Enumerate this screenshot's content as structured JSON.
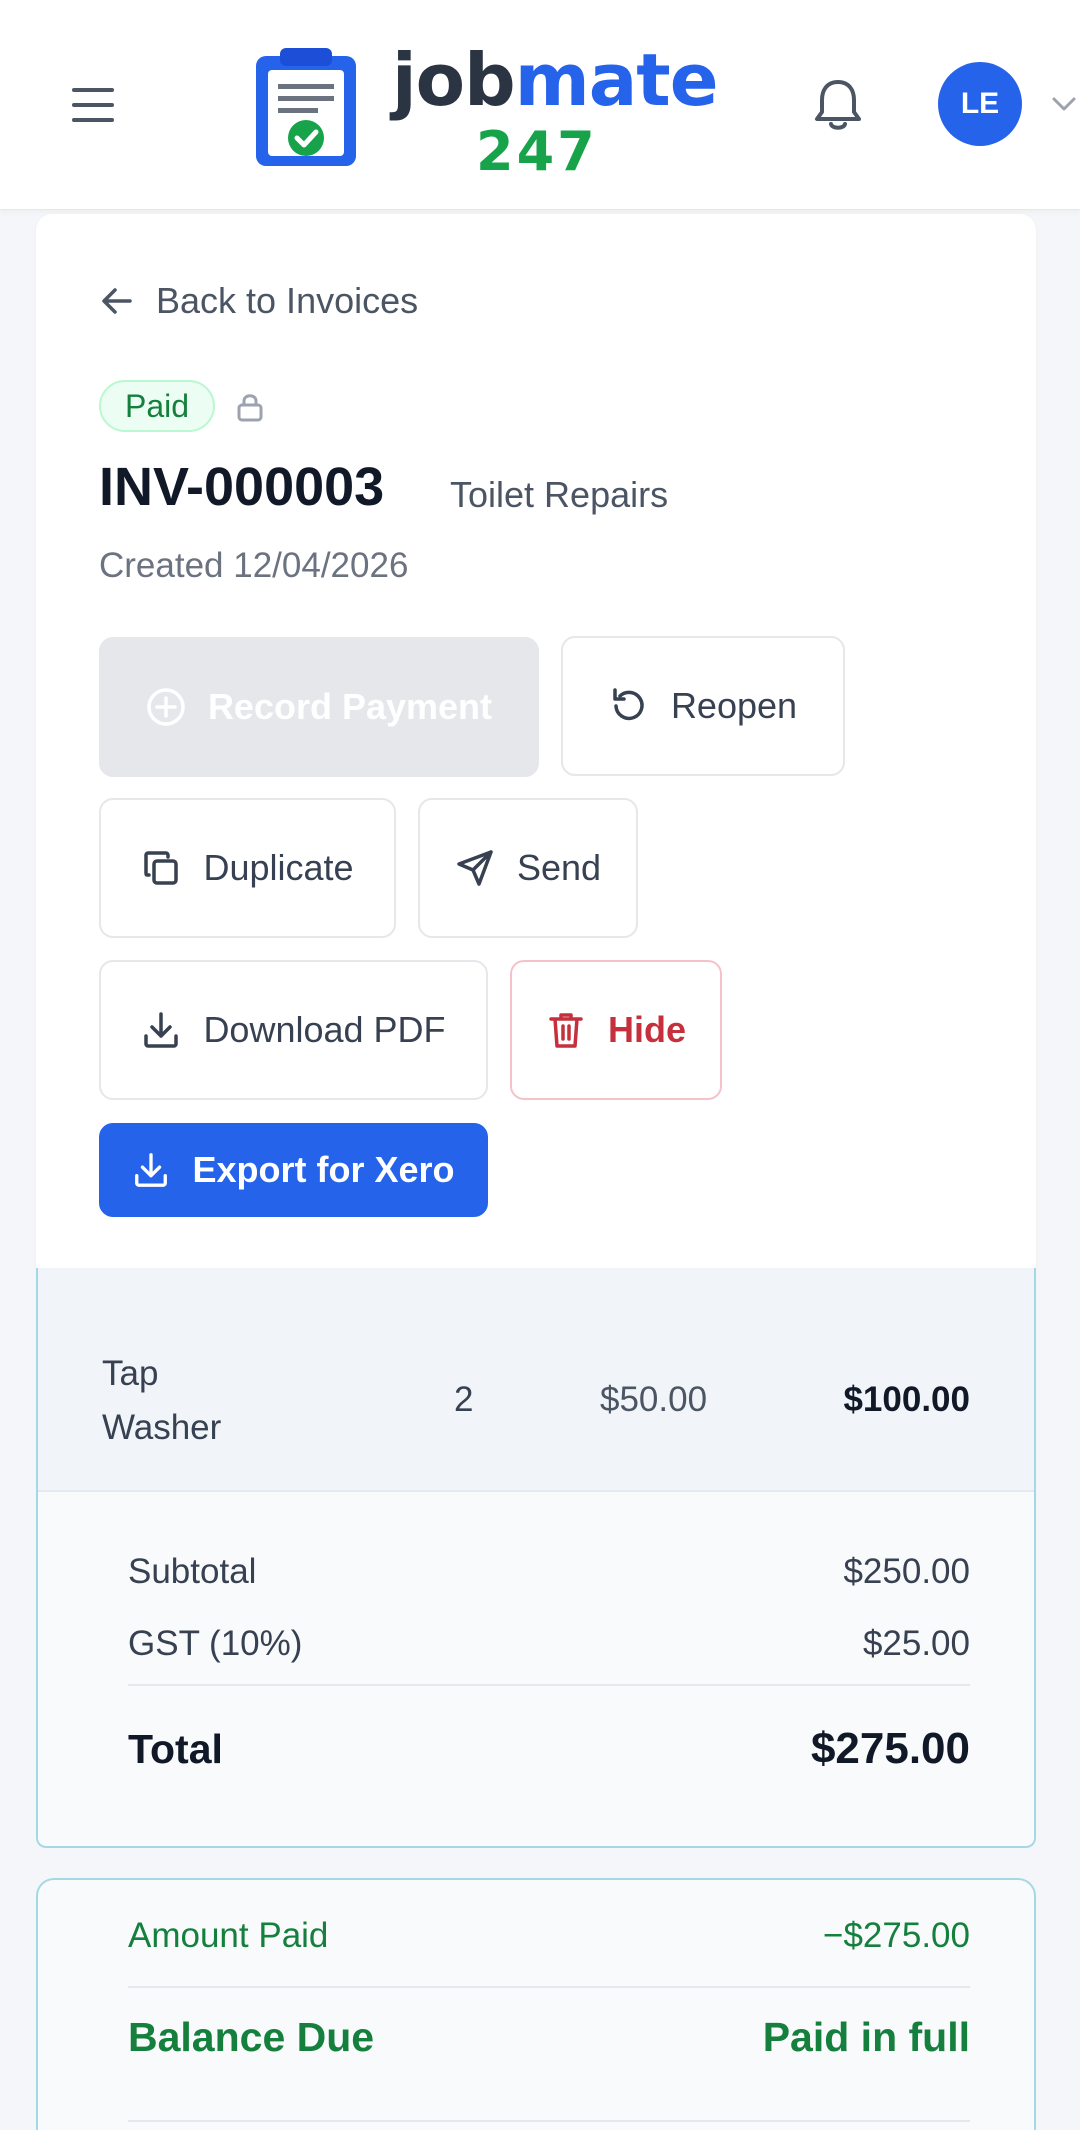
{
  "header": {
    "logo_job": "job",
    "logo_mate": "mate",
    "logo_num": "247",
    "avatar_initials": "LE"
  },
  "invoice": {
    "back_label": "Back to Invoices",
    "status": "Paid",
    "number": "INV-000003",
    "title": "Toilet Repairs",
    "created": "Created 12/04/2026"
  },
  "actions": {
    "record_payment": "Record Payment",
    "reopen": "Reopen",
    "duplicate": "Duplicate",
    "send": "Send",
    "download_pdf": "Download PDF",
    "hide": "Hide",
    "export_xero": "Export for Xero"
  },
  "line_items": [
    {
      "description_line1": "Tap",
      "description_line2": "Washer",
      "qty": "2",
      "unit_price": "$50.00",
      "amount": "$100.00"
    }
  ],
  "totals": {
    "subtotal_label": "Subtotal",
    "subtotal": "$250.00",
    "gst_label": "GST (10%)",
    "gst": "$25.00",
    "total_label": "Total",
    "total": "$275.00"
  },
  "payment": {
    "amount_paid_label": "Amount Paid",
    "amount_paid": "−$275.00",
    "balance_due_label": "Balance Due",
    "balance_due": "Paid in full"
  },
  "colors": {
    "brand_blue": "#2563eb",
    "brand_green": "#16a34a",
    "danger": "#c5303c"
  }
}
